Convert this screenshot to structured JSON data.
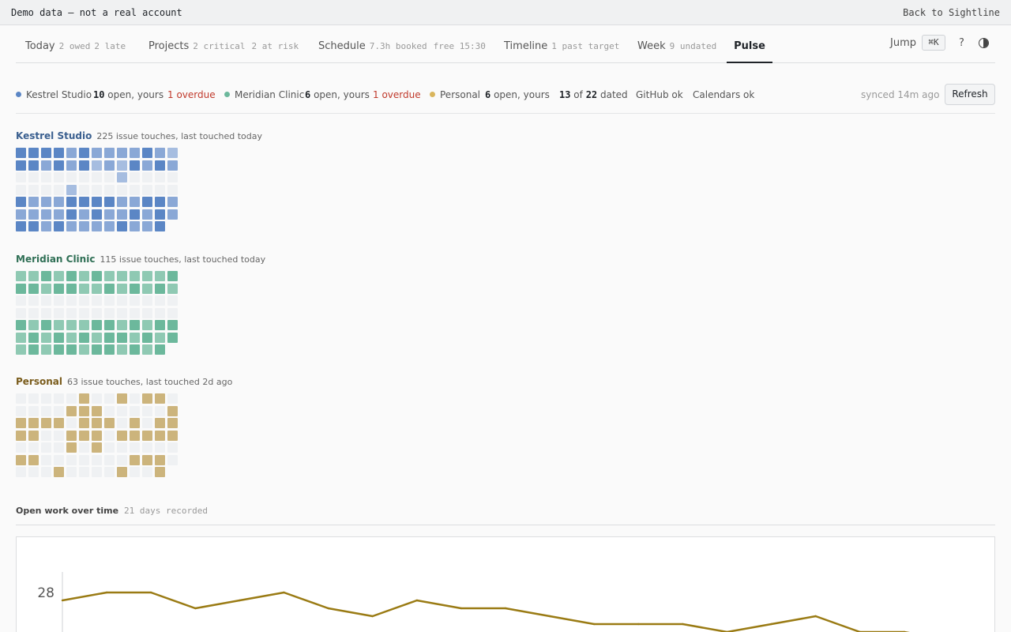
{
  "banner": {
    "left_text": "Demo data — not a real account",
    "right_link": "Back to Sightline"
  },
  "nav": {
    "tabs": [
      {
        "id": "today",
        "name": "Today",
        "meta": [
          "2 owed",
          "2 late"
        ]
      },
      {
        "id": "projects",
        "name": "Projects",
        "meta": [
          "2 critical",
          "2 at risk"
        ]
      },
      {
        "id": "schedule",
        "name": "Schedule",
        "meta": [
          "7.3h booked",
          "free 15:30"
        ]
      },
      {
        "id": "timeline",
        "name": "Timeline",
        "meta": [
          "1 past target"
        ]
      },
      {
        "id": "week",
        "name": "Week",
        "meta": [
          "9 undated"
        ]
      },
      {
        "id": "pulse",
        "name": "Pulse",
        "meta": []
      }
    ],
    "active_tab": "pulse",
    "jump_label": "Jump",
    "jump_shortcut": "⌘K",
    "help_label": "?",
    "theme_icon": "contrast-icon"
  },
  "status": {
    "kestrel_name": "Kestrel Studio",
    "kestrel_open": "10",
    "kestrel_open_label": "open, yours",
    "kestrel_overdue_num": "1",
    "kestrel_overdue_label": "overdue",
    "meridian_name": "Meridian Clinic",
    "meridian_open": "6",
    "meridian_open_label": "open, yours",
    "meridian_overdue_num": "1",
    "meridian_overdue_label": "overdue",
    "personal_name": "Personal",
    "personal_open": "6",
    "personal_open_label": "open, yours",
    "dated_num": "13",
    "dated_of": "of",
    "dated_total": "22",
    "dated_label": "dated",
    "github": "GitHub ok",
    "calendars": "Calendars ok",
    "synced": "synced 14m ago",
    "refresh": "Refresh"
  },
  "colors": {
    "kestrel": "#5b86c5",
    "meridian": "#6cb89c",
    "personal": "#d9b55c",
    "overdue": "#c0392b",
    "chart_line": "#9a7b14"
  },
  "projects": [
    {
      "name": "Kestrel Studio",
      "meta": "225 issue touches, last touched today",
      "name_color": "#3a5f8f",
      "levels": [
        "#eff1f3",
        "#a6bde0",
        "#8aa8d6",
        "#5b86c5"
      ],
      "grid": [
        [
          3,
          3,
          3,
          3,
          2,
          3,
          2,
          2,
          2,
          2,
          3,
          2,
          1
        ],
        [
          3,
          3,
          2,
          3,
          2,
          3,
          1,
          2,
          1,
          3,
          2,
          3,
          2
        ],
        [
          0,
          0,
          0,
          0,
          0,
          0,
          0,
          0,
          1,
          0,
          0,
          0,
          0
        ],
        [
          0,
          0,
          0,
          0,
          1,
          0,
          0,
          0,
          0,
          0,
          0,
          0,
          0
        ],
        [
          3,
          2,
          2,
          2,
          3,
          3,
          3,
          3,
          2,
          2,
          3,
          3,
          2
        ],
        [
          2,
          2,
          2,
          2,
          3,
          2,
          3,
          2,
          2,
          3,
          2,
          3,
          2
        ],
        [
          3,
          3,
          2,
          3,
          2,
          2,
          2,
          2,
          3,
          2,
          2,
          3,
          null
        ]
      ]
    },
    {
      "name": "Meridian Clinic",
      "meta": "115 issue touches, last touched today",
      "name_color": "#2f6f55",
      "levels": [
        "#eff1f3",
        "#a8d6c4",
        "#8fc9b3",
        "#6cb89c"
      ],
      "grid": [
        [
          2,
          2,
          3,
          2,
          3,
          2,
          3,
          2,
          2,
          2,
          2,
          2,
          3
        ],
        [
          3,
          3,
          2,
          3,
          3,
          2,
          2,
          3,
          2,
          3,
          2,
          3,
          2
        ],
        [
          0,
          0,
          0,
          0,
          0,
          0,
          0,
          0,
          0,
          0,
          0,
          0,
          0
        ],
        [
          0,
          0,
          0,
          0,
          0,
          0,
          0,
          0,
          0,
          0,
          0,
          0,
          0
        ],
        [
          3,
          2,
          3,
          2,
          2,
          2,
          3,
          3,
          2,
          3,
          2,
          3,
          3
        ],
        [
          2,
          3,
          2,
          3,
          2,
          3,
          2,
          3,
          3,
          2,
          3,
          2,
          3
        ],
        [
          2,
          3,
          2,
          3,
          3,
          2,
          3,
          3,
          2,
          3,
          2,
          3,
          null
        ]
      ]
    },
    {
      "name": "Personal",
      "meta": "63 issue touches, last touched 2d ago",
      "name_color": "#7a5c1c",
      "levels": [
        "#eff1f3",
        "#d8c79c",
        "#d3bb85",
        "#ccb47c"
      ],
      "grid": [
        [
          0,
          0,
          0,
          0,
          0,
          3,
          0,
          0,
          3,
          0,
          3,
          3,
          0
        ],
        [
          0,
          0,
          0,
          0,
          3,
          3,
          3,
          0,
          0,
          0,
          0,
          0,
          3
        ],
        [
          3,
          3,
          3,
          3,
          0,
          3,
          3,
          3,
          0,
          3,
          0,
          3,
          3
        ],
        [
          3,
          3,
          0,
          0,
          3,
          3,
          3,
          0,
          3,
          3,
          3,
          3,
          3
        ],
        [
          0,
          0,
          0,
          0,
          3,
          0,
          3,
          0,
          0,
          0,
          0,
          0,
          0
        ],
        [
          3,
          3,
          0,
          0,
          0,
          0,
          0,
          0,
          0,
          3,
          3,
          3,
          0
        ],
        [
          0,
          0,
          0,
          3,
          0,
          0,
          0,
          0,
          3,
          0,
          0,
          3,
          null
        ]
      ]
    }
  ],
  "section": {
    "title": "Open work over time",
    "meta": "21 days recorded"
  },
  "chart_data": {
    "type": "line",
    "title": "",
    "xlabel": "",
    "ylabel": "",
    "y_tick_labels": [
      "28"
    ],
    "series": [
      {
        "values": [
          27,
          28,
          28,
          26,
          27,
          28,
          26,
          25,
          27,
          26,
          26,
          25,
          24,
          24,
          24,
          23,
          24,
          25,
          23,
          23,
          22
        ]
      }
    ],
    "ylim": [
      17,
      29.2
    ],
    "grid": false
  }
}
